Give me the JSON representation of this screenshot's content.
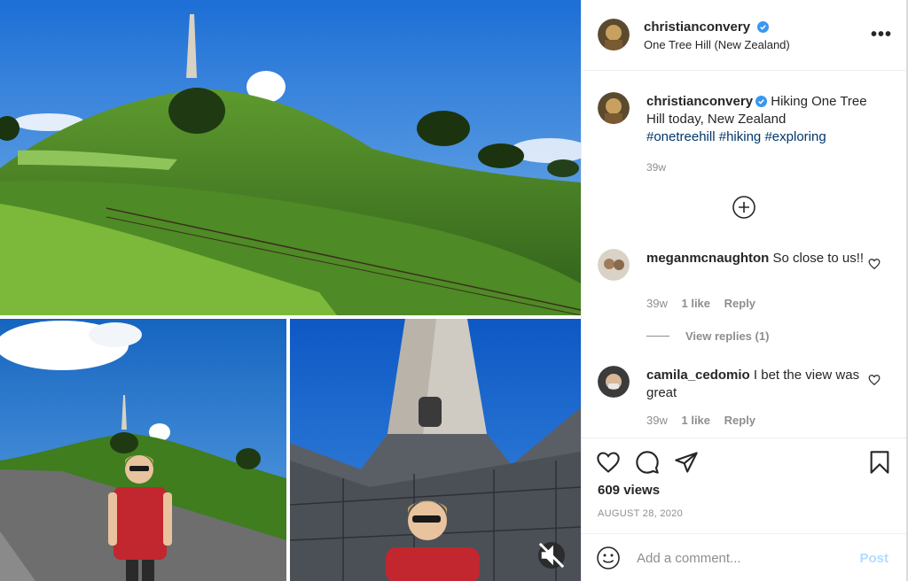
{
  "header": {
    "username": "christianconvery",
    "verified_icon": "verified-badge-icon",
    "location": "One Tree Hill (New Zealand)",
    "more_icon": "more-options-icon",
    "more_label": "•••"
  },
  "caption": {
    "username": "christianconvery",
    "text": " Hiking One Tree Hill today, New Zealand",
    "hashtags": [
      "#onetreehill",
      "#hiking",
      "#exploring"
    ],
    "time": "39w"
  },
  "comments": [
    {
      "username": "meganmcnaughton",
      "text": " So close to us!!",
      "time": "39w",
      "likes": "1 like",
      "reply_label": "Reply",
      "view_replies": "View replies (1)"
    },
    {
      "username": "camila_cedomio",
      "text": " I bet the view was great",
      "time": "39w",
      "likes": "1 like",
      "reply_label": "Reply"
    }
  ],
  "actions": {
    "icons": [
      "heart-icon",
      "comment-icon",
      "share-icon",
      "bookmark-icon"
    ],
    "views": "609 views",
    "date": "AUGUST 28, 2020"
  },
  "add_comment": {
    "placeholder": "Add a comment...",
    "post_label": "Post"
  },
  "colors": {
    "link": "#00376b",
    "verified": "#3897f0",
    "muted": "#8e8e8e",
    "post_disabled": "#b3dbff"
  }
}
